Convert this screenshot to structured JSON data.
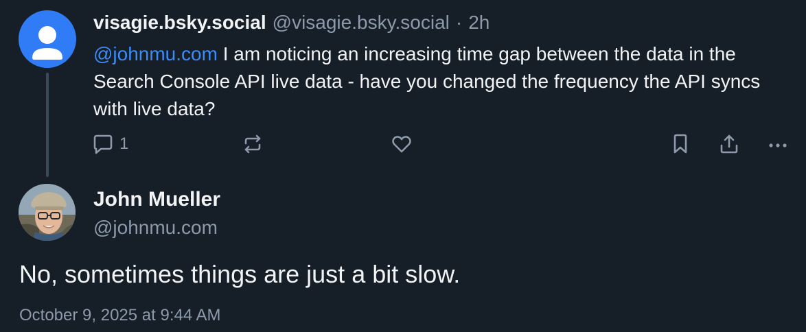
{
  "parent_post": {
    "display_name": "visagie.bsky.social",
    "handle": "@visagie.bsky.social",
    "separator": "·",
    "time_ago": "2h",
    "mention": "@johnmu.com",
    "text": " I am noticing an increasing time gap between the data in the Search Console API live data - have you changed the frequency the API syncs with live data?",
    "actions": {
      "reply_icon": "comment-icon",
      "reply_count": "1",
      "repost_icon": "repost-icon",
      "like_icon": "heart-icon",
      "bookmark_icon": "bookmark-icon",
      "share_icon": "share-icon",
      "more_icon": "ellipsis-icon"
    }
  },
  "reply_post": {
    "display_name": "John Mueller",
    "handle": "@johnmu.com",
    "text": "No, sometimes things are just a bit slow.",
    "date": "October 9, 2025 at 9:44 AM"
  },
  "colors": {
    "background": "#161e27",
    "text": "#f1f3f5",
    "muted": "#8c9aab",
    "link": "#3b8cf6",
    "default_avatar": "#2f7cf6"
  }
}
